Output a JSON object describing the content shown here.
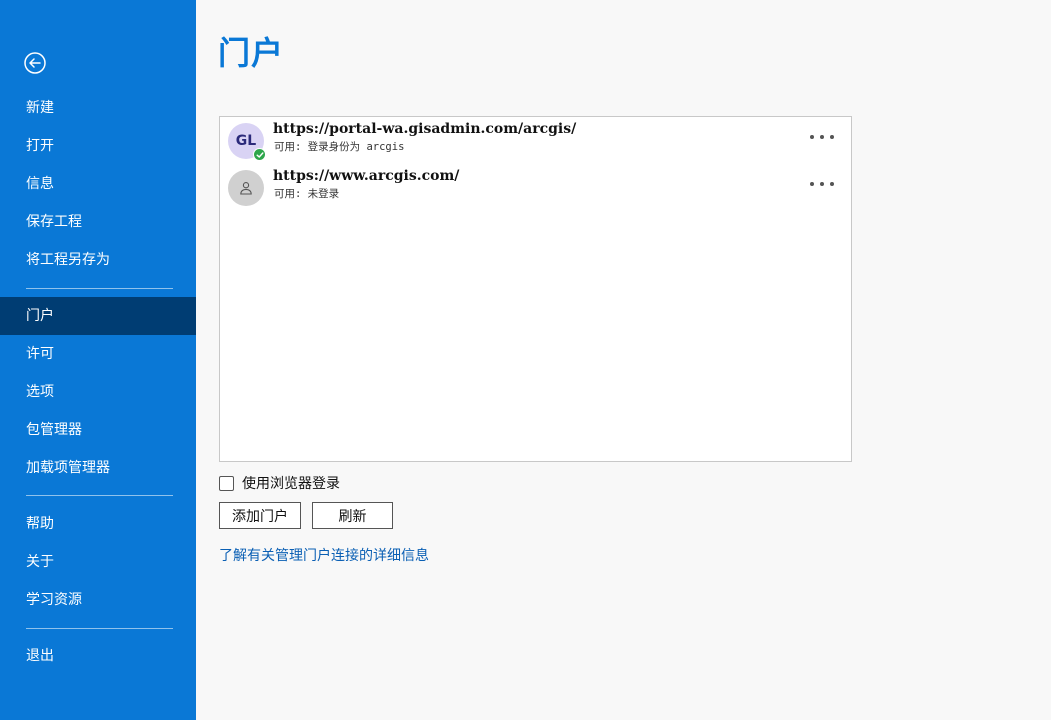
{
  "sidebar": {
    "items": [
      {
        "label": "新建"
      },
      {
        "label": "打开"
      },
      {
        "label": "信息"
      },
      {
        "label": "保存工程"
      },
      {
        "label": "将工程另存为"
      },
      {
        "label": "门户"
      },
      {
        "label": "许可"
      },
      {
        "label": "选项"
      },
      {
        "label": "包管理器"
      },
      {
        "label": "加载项管理器"
      },
      {
        "label": "帮助"
      },
      {
        "label": "关于"
      },
      {
        "label": "学习资源"
      },
      {
        "label": "退出"
      }
    ],
    "active": "门户"
  },
  "main": {
    "title": "门户",
    "portals": [
      {
        "avatar": "GL",
        "url": "https://portal-wa.gisadmin.com/arcgis/",
        "status": "可用: 登录身份为 arcgis"
      },
      {
        "avatar": "person-icon",
        "url": "https://www.arcgis.com/",
        "status": "可用: 未登录"
      }
    ],
    "browser_login_label": "使用浏览器登录",
    "add_portal_label": "添加门户",
    "refresh_label": "刷新",
    "learn_more_link": "了解有关管理门户连接的详细信息"
  },
  "colors": {
    "sidebar_bg": "#0a78d6",
    "active_item_bg": "#003d73",
    "title": "#0a78d6",
    "link": "#0a5fb4",
    "status_ok": "#2ea64b"
  }
}
